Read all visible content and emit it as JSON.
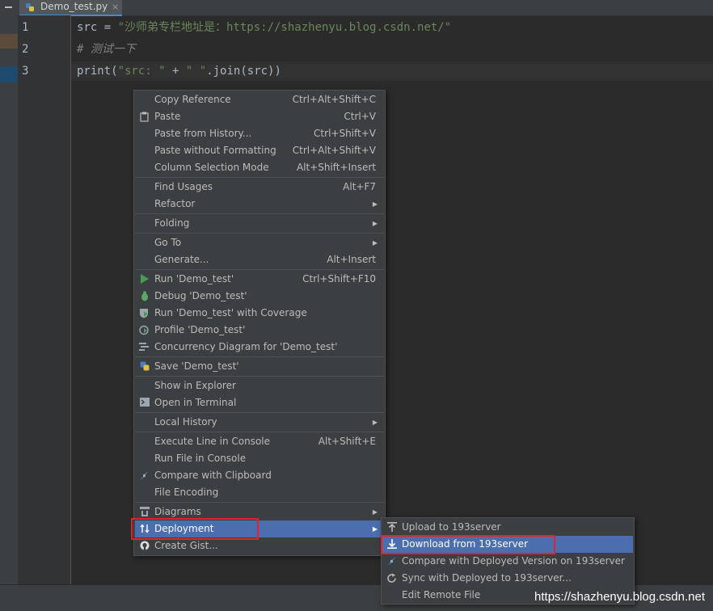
{
  "tab": {
    "title": "Demo_test.py",
    "close": "×"
  },
  "editor": {
    "line_numbers": [
      "1",
      "2",
      "3"
    ],
    "lines": [
      {
        "p1": "src = ",
        "p2": "\"沙师弟专栏地址是：https://shazhenyu.blog.csdn.net/\""
      },
      {
        "p1": "# 测试一下"
      },
      {
        "p1": "print(",
        "p2": "\"src: \"",
        "p3": " + ",
        "p4": "\" \"",
        "p5": ".join(src))"
      }
    ]
  },
  "context_menu": {
    "items": [
      {
        "label": "Copy Reference",
        "shortcut": "Ctrl+Alt+Shift+C"
      },
      {
        "label": "Paste",
        "shortcut": "Ctrl+V",
        "icon": "clipboard-icon"
      },
      {
        "label": "Paste from History...",
        "shortcut": "Ctrl+Shift+V"
      },
      {
        "label": "Paste without Formatting",
        "shortcut": "Ctrl+Alt+Shift+V"
      },
      {
        "label": "Column Selection Mode",
        "shortcut": "Alt+Shift+Insert"
      },
      {
        "label": "Find Usages",
        "shortcut": "Alt+F7"
      },
      {
        "label": "Refactor",
        "submenu": true
      },
      {
        "label": "Folding",
        "submenu": true
      },
      {
        "label": "Go To",
        "submenu": true
      },
      {
        "label": "Generate...",
        "shortcut": "Alt+Insert"
      },
      {
        "label": "Run 'Demo_test'",
        "shortcut": "Ctrl+Shift+F10",
        "icon": "run-icon"
      },
      {
        "label": "Debug 'Demo_test'",
        "icon": "debug-icon"
      },
      {
        "label": "Run 'Demo_test' with Coverage",
        "icon": "coverage-icon"
      },
      {
        "label": "Profile 'Demo_test'",
        "icon": "profile-icon"
      },
      {
        "label": "Concurrency Diagram for 'Demo_test'",
        "icon": "concurrency-icon"
      },
      {
        "label": "Save 'Demo_test'",
        "icon": "python-icon"
      },
      {
        "label": "Show in Explorer"
      },
      {
        "label": "Open in Terminal",
        "icon": "terminal-icon"
      },
      {
        "label": "Local History",
        "submenu": true
      },
      {
        "label": "Execute Line in Console",
        "shortcut": "Alt+Shift+E"
      },
      {
        "label": "Run File in Console"
      },
      {
        "label": "Compare with Clipboard",
        "icon": "compare-icon"
      },
      {
        "label": "File Encoding"
      },
      {
        "label": "Diagrams",
        "submenu": true,
        "icon": "diagram-icon"
      },
      {
        "label": "Deployment",
        "submenu": true,
        "icon": "deployment-icon",
        "selected": true
      },
      {
        "label": "Create Gist...",
        "icon": "github-icon"
      }
    ]
  },
  "submenu": {
    "items": [
      {
        "label": "Upload to 193server",
        "icon": "upload-icon"
      },
      {
        "label": "Download from 193server",
        "icon": "download-icon",
        "selected": true
      },
      {
        "label": "Compare with Deployed Version on 193server",
        "icon": "compare-icon"
      },
      {
        "label": "Sync with Deployed to 193server...",
        "icon": "sync-icon"
      },
      {
        "label": "Edit Remote File"
      }
    ]
  },
  "watermark": "https://shazhenyu.blog.csdn.net",
  "colors": {
    "selection": "#4b6eaf",
    "highlight_box": "#e2232a",
    "string": "#6a8759",
    "comment": "#808080"
  }
}
